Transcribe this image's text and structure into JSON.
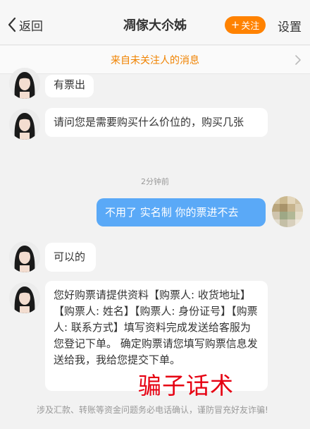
{
  "header": {
    "back_label": "返回",
    "title": "凋傢大尒姊",
    "follow_label": "关注",
    "settings_label": "设置"
  },
  "notice": {
    "text": "来自未关注人的消息"
  },
  "messages": [
    {
      "text": "有票出"
    },
    {
      "text": "请问您是需要购买什么价位的，购买几张"
    },
    {
      "text": "不用了 实名制 你的票进不去"
    },
    {
      "text": "可以的"
    },
    {
      "text": "您好购票请提供资料【购票人: 收货地址】【购票人: 姓名】【购票人: 身份证号】【购票人: 联系方式】填写资料完成发送给客服为您登记下单。 确定购票请您填写购票信息发送给我，我给您提交下单。"
    }
  ],
  "timestamp": "2分钟前",
  "overlay_caption": "骗子话术",
  "warning": "涉及汇款、转账等资金问题务必电话确认，谨防冒充好友诈骗!",
  "colors": {
    "accent_orange": "#ff8200",
    "outgoing_bubble": "#5aa9f7",
    "caption_red": "#e60012"
  }
}
